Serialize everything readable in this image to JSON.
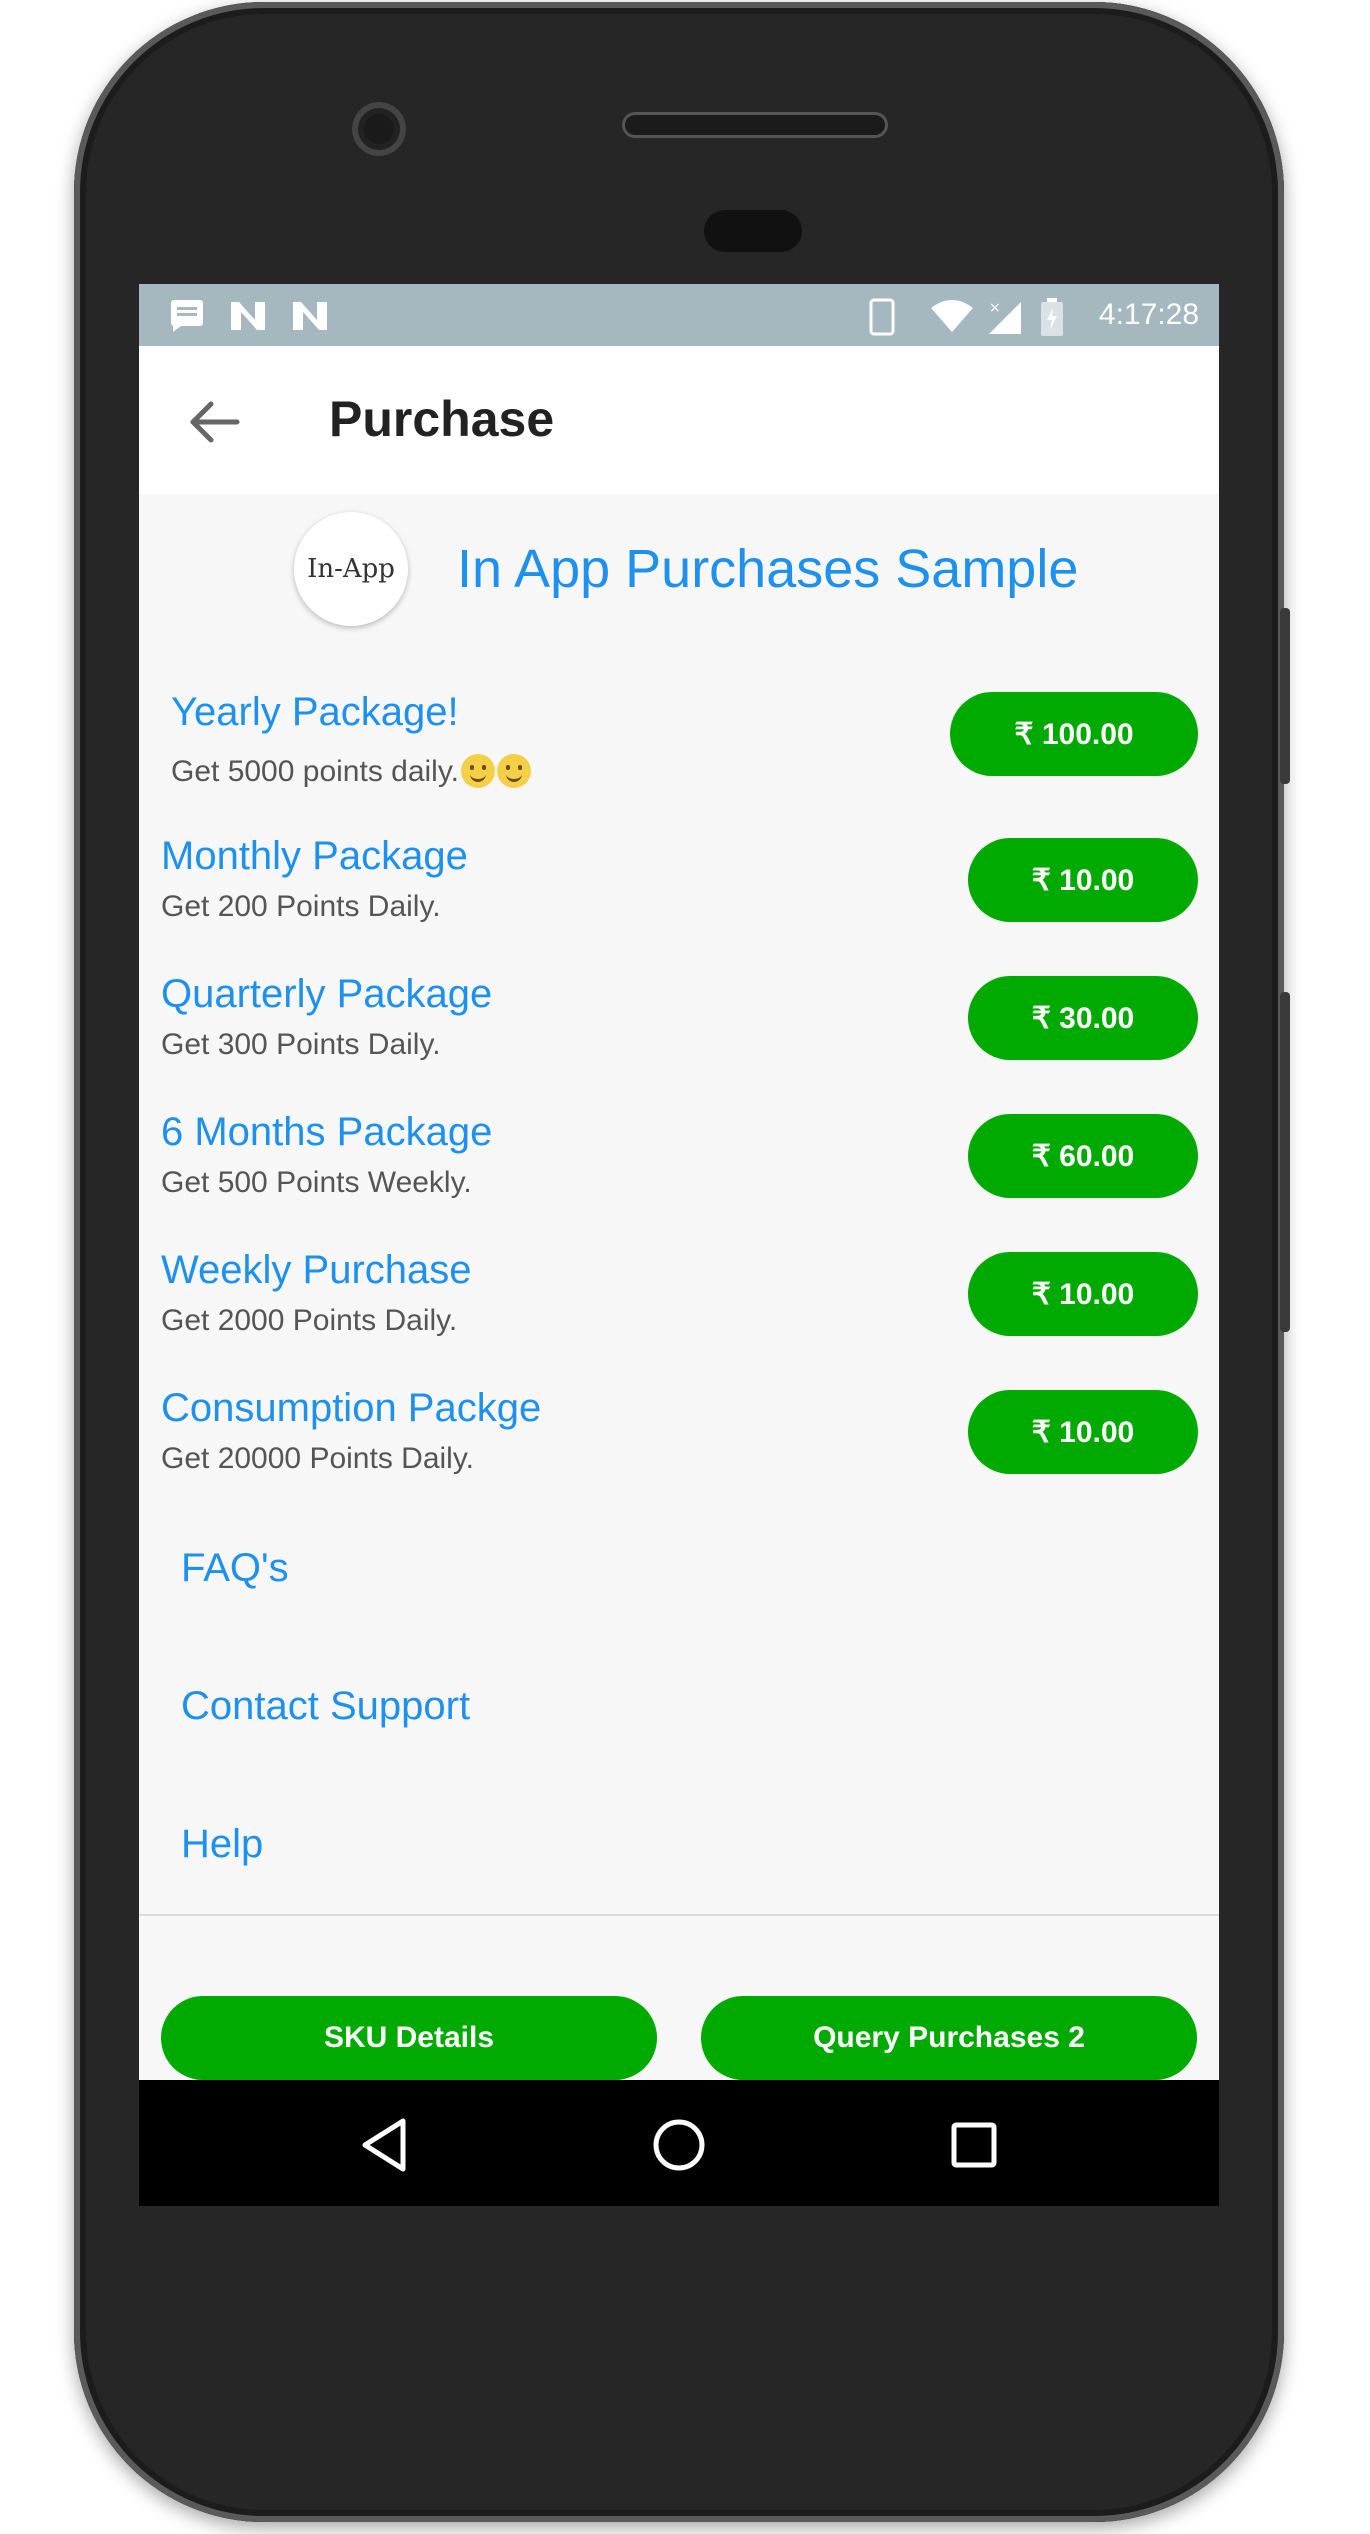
{
  "statusbar": {
    "time": "4:17:28"
  },
  "appbar": {
    "title": "Purchase"
  },
  "header": {
    "logo_text": "In-App",
    "title": "In App Purchases Sample"
  },
  "packages": [
    {
      "title": "Yearly Package!",
      "description": "Get 5000 points daily.",
      "price": "₹ 100.00"
    },
    {
      "title": "Monthly Package",
      "description": "Get 200 Points Daily.",
      "price": "₹ 10.00"
    },
    {
      "title": "Quarterly Package",
      "description": "Get 300 Points Daily.",
      "price": "₹ 30.00"
    },
    {
      "title": "6 Months Package",
      "description": "Get 500 Points Weekly.",
      "price": "₹ 60.00"
    },
    {
      "title": "Weekly Purchase",
      "description": "Get 2000 Points Daily.",
      "price": "₹ 10.00"
    },
    {
      "title": "Consumption Packge",
      "description": "Get 20000 Points Daily.",
      "price": "₹ 10.00"
    }
  ],
  "links": [
    {
      "label": "FAQ's"
    },
    {
      "label": "Contact Support"
    },
    {
      "label": "Help"
    }
  ],
  "bottom_buttons": {
    "sku_details": "SKU Details",
    "query_purchases": "Query Purchases 2"
  },
  "colors": {
    "accent_blue": "#1e90ee",
    "button_green": "#00aa00",
    "statusbar": "#a5b7bf"
  },
  "icons": {
    "status_left": [
      "notification-icon",
      "n-icon",
      "n-icon"
    ],
    "status_right": [
      "phone-icon",
      "wifi-icon",
      "signal-icon",
      "battery-charging-icon"
    ],
    "nav": [
      "back-triangle-icon",
      "home-circle-icon",
      "recents-square-icon"
    ]
  }
}
